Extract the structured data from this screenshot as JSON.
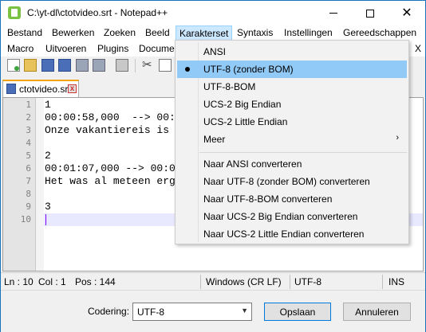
{
  "window": {
    "title": "C:\\yt-dl\\ctotvideo.srt - Notepad++"
  },
  "menu": {
    "row1": [
      "Bestand",
      "Bewerken",
      "Zoeken",
      "Beeld",
      "Karakterset",
      "Syntaxis",
      "Instellingen",
      "Gereedschappen"
    ],
    "row2": [
      "Macro",
      "Uitvoeren",
      "Plugins",
      "Docume"
    ],
    "close_x": "X"
  },
  "tab": {
    "label": "ctotvideo.srt",
    "close": "x"
  },
  "editor": {
    "line_numbers": [
      "1",
      "2",
      "3",
      "4",
      "5",
      "6",
      "7",
      "8",
      "9",
      "10"
    ],
    "lines": [
      "1",
      "00:00:58,000  --> 00:",
      "Onze vakantiereis is",
      "",
      "2",
      "00:01:07,000 --> 00:0",
      "Het was al meteen erg",
      "",
      "3",
      ""
    ]
  },
  "dropdown": {
    "items": [
      {
        "label": "ANSI"
      },
      {
        "label": "UTF-8 (zonder BOM)",
        "selected": true
      },
      {
        "label": "UTF-8-BOM"
      },
      {
        "label": "UCS-2 Big Endian"
      },
      {
        "label": "UCS-2 Little Endian"
      },
      {
        "label": "Meer",
        "submenu": true
      }
    ],
    "convert_items": [
      {
        "label": "Naar ANSI converteren"
      },
      {
        "label": "Naar UTF-8 (zonder BOM) converteren"
      },
      {
        "label": "Naar UTF-8-BOM converteren"
      },
      {
        "label": "Naar UCS-2 Big Endian converteren"
      },
      {
        "label": "Naar UCS-2 Little Endian converteren"
      }
    ]
  },
  "statusbar": {
    "ln": "Ln : 10",
    "col": "Col : 1",
    "pos": "Pos : 144",
    "eol": "Windows (CR LF)",
    "encoding": "UTF-8",
    "mode": "INS"
  },
  "bottom": {
    "coding_label": "Codering:",
    "coding_value": "UTF-8",
    "save_label": "Opslaan",
    "cancel_label": "Annuleren"
  }
}
